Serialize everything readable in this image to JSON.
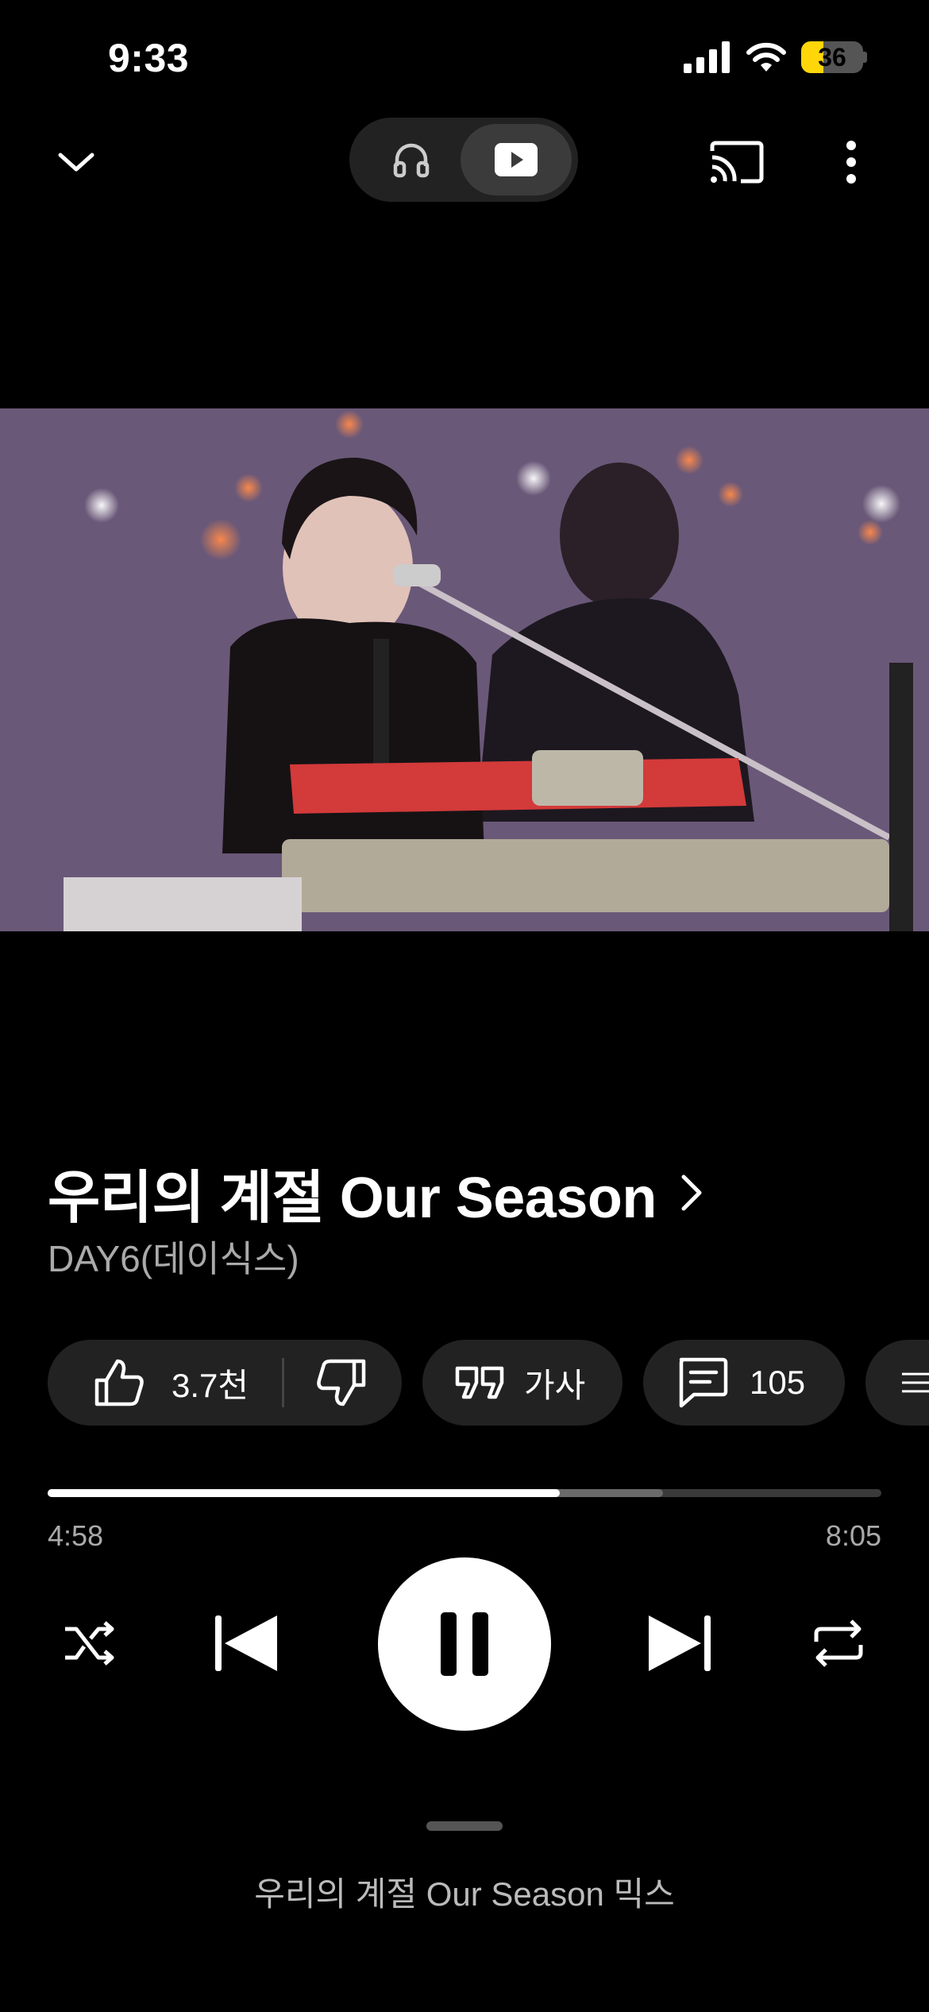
{
  "status_bar": {
    "time": "9:33",
    "battery": "36",
    "battery_level": 0.36
  },
  "top_bar": {
    "collapse_icon": "chevron-down-icon",
    "mode_audio_icon": "headphones-icon",
    "mode_video_icon": "video-play-icon",
    "cast_icon": "cast-icon",
    "more_icon": "more-vertical-icon"
  },
  "song": {
    "title": "우리의 계절 Our Season",
    "artist": "DAY6(데이식스)"
  },
  "actions": {
    "like_count": "3.7천",
    "lyrics_label": "가사",
    "comments_count": "105"
  },
  "progress": {
    "current_time": "4:58",
    "total_time": "8:05",
    "played_fraction": 0.614,
    "buffered_fraction": 0.738
  },
  "up_next": {
    "label": "우리의 계절 Our Season 믹스"
  },
  "colors": {
    "background": "#000000",
    "chip": "#222222",
    "battery": "#ffd60a"
  }
}
